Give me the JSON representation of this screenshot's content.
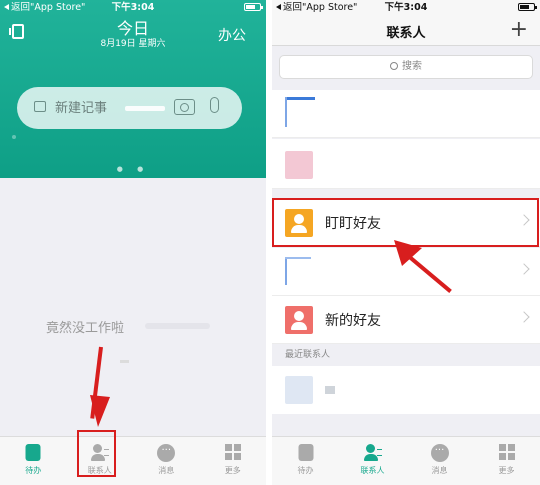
{
  "left_phone": {
    "status": {
      "back_label": "返回\"App Store\"",
      "time": "下午3:04"
    },
    "header": {
      "title": "今日",
      "date": "8月19日 星期六",
      "right_action": "办公"
    },
    "memo": {
      "placeholder": "新建记事"
    },
    "empty_message": "竟然没工作啦",
    "tabs": [
      {
        "label": "待办",
        "icon": "todo-icon"
      },
      {
        "label": "联系人",
        "icon": "contacts-icon"
      },
      {
        "label": "消息",
        "icon": "message-icon"
      },
      {
        "label": "更多",
        "icon": "more-grid-icon"
      }
    ]
  },
  "right_phone": {
    "status": {
      "back_label": "返回\"App Store\"",
      "time": "下午3:04"
    },
    "nav": {
      "title": "联系人",
      "add_icon": "+"
    },
    "search": {
      "placeholder": "搜索"
    },
    "rows": [
      {
        "label": "",
        "avatar_color": "#3b7ad9"
      },
      {
        "label": "",
        "avatar_color": "#f0b6c6"
      },
      {
        "label": "盯盯好友",
        "avatar_color": "#f5a623",
        "highlighted": true
      },
      {
        "label": "",
        "avatar_color": "#3b7ad9"
      },
      {
        "label": "新的好友",
        "avatar_color": "#ef6f6a"
      }
    ],
    "section_recent": "最近联系人",
    "tabs": [
      {
        "label": "待办",
        "icon": "todo-icon"
      },
      {
        "label": "联系人",
        "icon": "contacts-icon"
      },
      {
        "label": "消息",
        "icon": "message-icon"
      },
      {
        "label": "更多",
        "icon": "more-grid-icon"
      }
    ]
  },
  "colors": {
    "brand_green": "#17a88d",
    "annotation_red": "#d81e1e"
  }
}
